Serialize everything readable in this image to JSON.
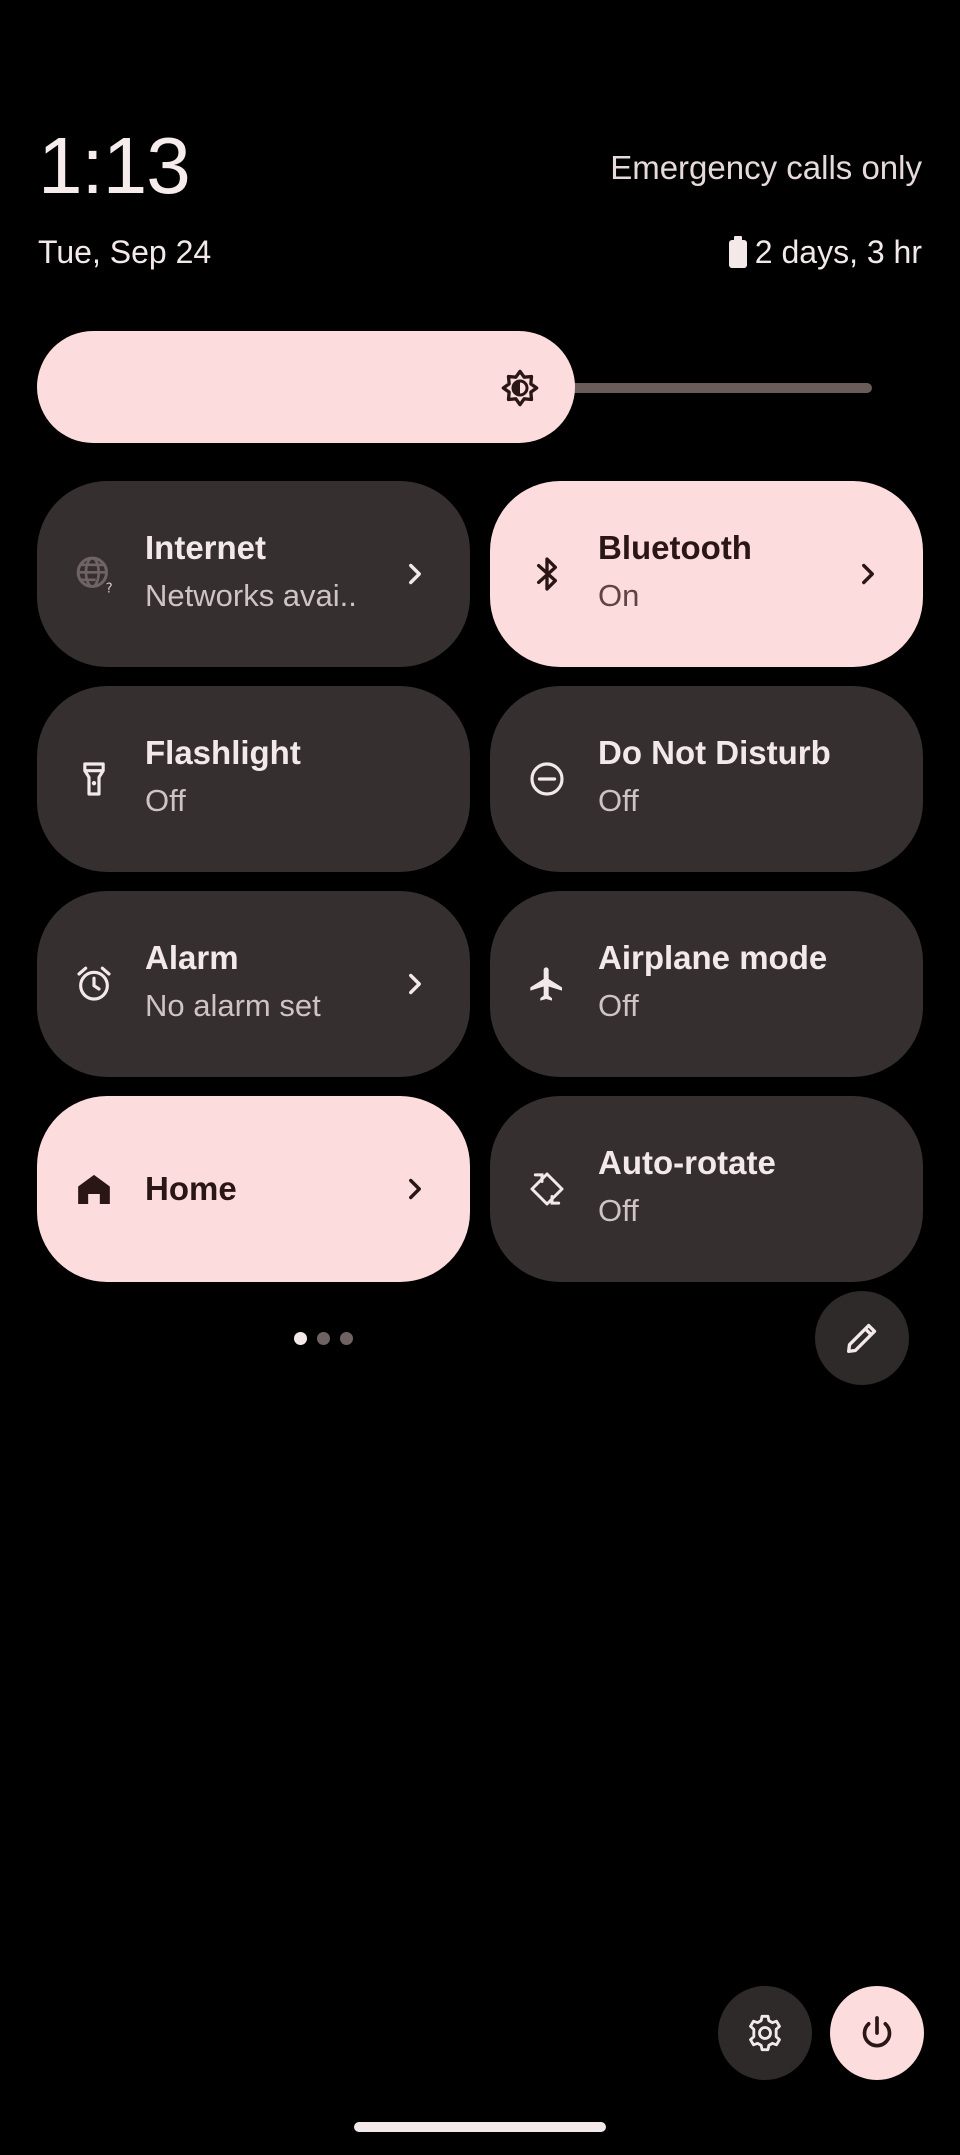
{
  "status": {
    "time": "1:13",
    "carrier": "Emergency calls only",
    "date": "Tue, Sep 24",
    "battery": "2 days, 3 hr"
  },
  "brightness": {
    "level": 0.66
  },
  "tiles": [
    {
      "title": "Internet",
      "subtitle": "Networks avai..",
      "icon": "globe-question-icon",
      "active": false,
      "chevron": true
    },
    {
      "title": "Bluetooth",
      "subtitle": "On",
      "icon": "bluetooth-icon",
      "active": true,
      "chevron": true
    },
    {
      "title": "Flashlight",
      "subtitle": "Off",
      "icon": "flashlight-icon",
      "active": false,
      "chevron": false
    },
    {
      "title": "Do Not Disturb",
      "subtitle": "Off",
      "icon": "do-not-disturb-icon",
      "active": false,
      "chevron": false
    },
    {
      "title": "Alarm",
      "subtitle": "No alarm set",
      "icon": "alarm-clock-icon",
      "active": false,
      "chevron": true
    },
    {
      "title": "Airplane mode",
      "subtitle": "Off",
      "icon": "airplane-icon",
      "active": false,
      "chevron": false
    },
    {
      "title": "Home",
      "subtitle": "",
      "icon": "home-icon",
      "active": true,
      "chevron": true
    },
    {
      "title": "Auto-rotate",
      "subtitle": "Off",
      "icon": "auto-rotate-icon",
      "active": false,
      "chevron": false
    }
  ],
  "pagination": {
    "pages": 3,
    "current": 1
  },
  "colors": {
    "background": "#000000",
    "tile_inactive": "#352f2f",
    "tile_active": "#fcdcdc",
    "text_primary": "#f3e9e9",
    "text_on_active": "#2b1616"
  }
}
